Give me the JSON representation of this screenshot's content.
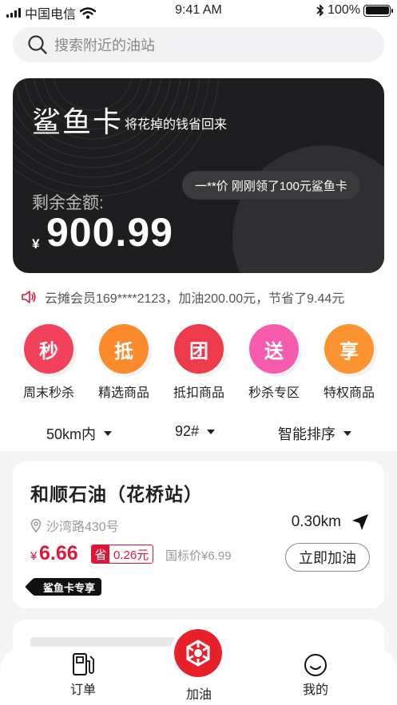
{
  "status_bar": {
    "carrier": "中国电信",
    "time": "9:41 AM",
    "battery": "100%",
    "battery_level": 1.0
  },
  "search": {
    "placeholder": "搜索附近的油站"
  },
  "card": {
    "title": "鲨鱼卡",
    "subtitle": "将花掉的钱省回来",
    "ticker": "一**价 刚刚领了100元鲨鱼卡",
    "balance_label": "剩余金额:",
    "currency": "¥",
    "balance": "900.99"
  },
  "notice": {
    "text": "云摊会员169****2123，加油200.00元，节省了9.44元"
  },
  "categories": [
    {
      "glyph": "秒",
      "label": "周末秒杀",
      "color": "#f2415a"
    },
    {
      "glyph": "抵",
      "label": "精选商品",
      "color": "#fb8a2c"
    },
    {
      "glyph": "团",
      "label": "抵扣商品",
      "color": "#ee3b4b"
    },
    {
      "glyph": "送",
      "label": "秒杀专区",
      "color": "#f65cae"
    },
    {
      "glyph": "享",
      "label": "特权商品",
      "color": "#fb9330"
    }
  ],
  "filters": {
    "distance": "50km内",
    "fuel": "92#",
    "sort": "智能排序"
  },
  "station": {
    "name": "和顺石油（花桥站）",
    "address": "沙湾路430号",
    "distance": "0.30km",
    "currency": "¥",
    "price": "6.66",
    "save_label": "省",
    "save_value": "0.26元",
    "ref_price": "国标价¥6.99",
    "action": "立即加油",
    "tag": "鲨鱼卡专享"
  },
  "tabbar": {
    "orders": "订单",
    "fuel": "加油",
    "mine": "我的"
  },
  "icons": {
    "search": "search-icon",
    "speaker": "speaker-icon",
    "location": "location-pin-icon",
    "navigate": "navigation-arrow-icon",
    "fuel_pump": "fuel-pump-icon",
    "logo": "brand-logo-icon",
    "smile": "smile-icon"
  }
}
